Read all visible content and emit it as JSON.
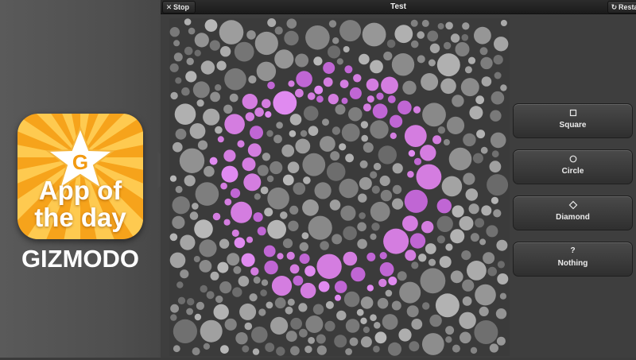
{
  "promo": {
    "icon_letter": "G",
    "icon_line1": "App of",
    "icon_line2": "the day",
    "brand": "GIZMODO",
    "colors": {
      "icon_bg": "#f6b21b",
      "icon_ray": "#ffd25a"
    }
  },
  "toolbar": {
    "stop_label": "Stop",
    "stop_icon": "close-icon",
    "title": "Test",
    "restart_label": "Resta",
    "restart_icon": "refresh-icon"
  },
  "plate": {
    "figure_color": "#d47de0",
    "background_dot_color": "#9a9a9a"
  },
  "choices": [
    {
      "label": "Square",
      "icon": "square-icon"
    },
    {
      "label": "Circle",
      "icon": "circle-icon"
    },
    {
      "label": "Diamond",
      "icon": "diamond-icon"
    },
    {
      "label": "Nothing",
      "icon": "question-icon",
      "symbol": "?"
    }
  ]
}
